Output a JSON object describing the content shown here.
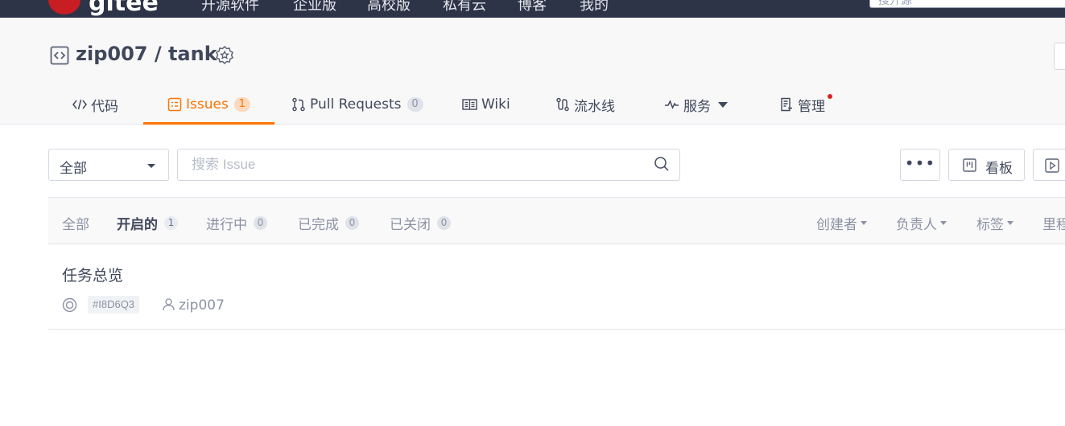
{
  "topnav": {
    "brand": "gitee",
    "items": [
      "开源软件",
      "企业版",
      "高校版",
      "私有云",
      "博客",
      "我的"
    ],
    "search_placeholder": "搜开源"
  },
  "repo": {
    "owner": "zip007",
    "separator": "/",
    "name": "tank",
    "title": "zip007 / tank"
  },
  "tabs": [
    {
      "label": "代码",
      "icon": "code-icon"
    },
    {
      "label": "Issues",
      "count": "1",
      "icon": "issue-icon",
      "active": true
    },
    {
      "label": "Pull Requests",
      "count": "0",
      "icon": "pull-request-icon"
    },
    {
      "label": "Wiki",
      "icon": "book-icon"
    },
    {
      "label": "流水线",
      "icon": "pipeline-icon"
    },
    {
      "label": "服务",
      "icon": "pulse-icon",
      "dropdown": true
    },
    {
      "label": "管理",
      "icon": "manage-icon",
      "notification_dot": true
    }
  ],
  "filter": {
    "scope_value": "全部",
    "search_placeholder": "搜索 Issue",
    "more_label": "•••",
    "board_label": "看板"
  },
  "status_filters": [
    {
      "label": "全部"
    },
    {
      "label": "开启的",
      "count": "1",
      "active": true
    },
    {
      "label": "进行中",
      "count": "0"
    },
    {
      "label": "已完成",
      "count": "0"
    },
    {
      "label": "已关闭",
      "count": "0"
    }
  ],
  "column_filters": [
    "创建者",
    "负责人",
    "标签",
    "里程"
  ],
  "issues": [
    {
      "title": "任务总览",
      "id": "#I8D6Q3",
      "author": "zip007",
      "status_icon": "open-circle-icon"
    }
  ],
  "colors": {
    "accent": "#fe7300",
    "nav_bg": "#2e3447",
    "brand_red": "#c71d23"
  }
}
